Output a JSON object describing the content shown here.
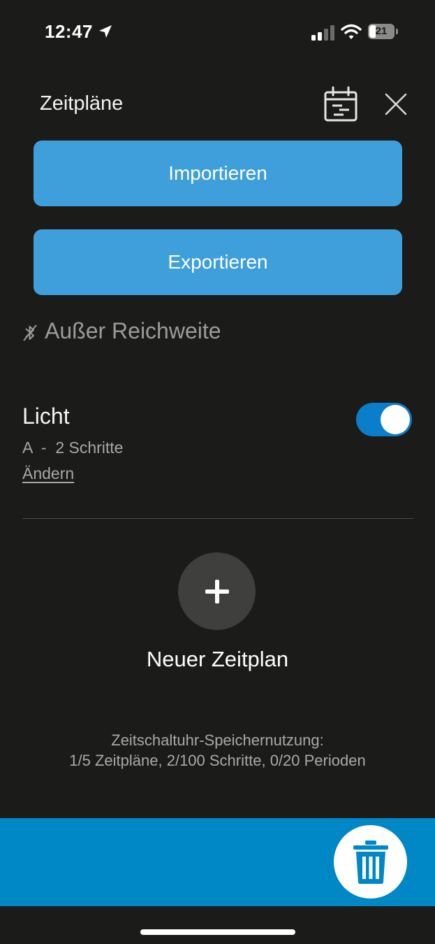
{
  "status_bar": {
    "time": "12:47",
    "battery": "21"
  },
  "header": {
    "title": "Zeitpläne"
  },
  "actions": {
    "import_label": "Importieren",
    "export_label": "Exportieren"
  },
  "connection": {
    "status": "Außer Reichweite"
  },
  "schedules": [
    {
      "name": "Licht",
      "program": "A",
      "steps": "2 Schritte",
      "edit_label": "Ändern",
      "enabled": true
    }
  ],
  "new_schedule": {
    "label": "Neuer Zeitplan"
  },
  "usage": {
    "title": "Zeitschaltuhr-Speichernutzung:",
    "details": "1/5 Zeitpläne, 2/100 Schritte, 0/20 Perioden"
  },
  "colors": {
    "background": "#1b1b19",
    "button": "#3f9fdb",
    "bottom_bar": "#0087c6",
    "toggle_on": "#0a7ec8"
  },
  "icons": [
    "location-arrow-icon",
    "signal-icon",
    "wifi-icon",
    "battery-icon",
    "calendar-icon",
    "close-icon",
    "no-bluetooth-icon",
    "plus-icon",
    "trash-icon"
  ]
}
